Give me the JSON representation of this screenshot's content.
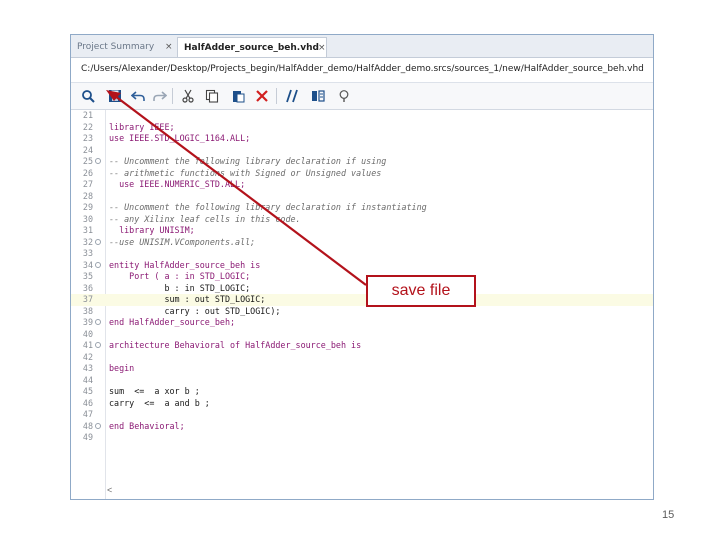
{
  "tabs": [
    {
      "label": "Project Summary",
      "close": "×"
    },
    {
      "label": "HalfAdder_source_beh.vhd *",
      "close": "×"
    }
  ],
  "file_path": "C:/Users/Alexander/Desktop/Projects_begin/HalfAdder_demo/HalfAdder_demo.srcs/sources_1/new/HalfAdder_source_beh.vhd",
  "toolbar_icons": [
    "search-icon",
    "save-icon",
    "undo-icon",
    "redo-icon",
    "cut-icon",
    "copy-icon",
    "paste-icon",
    "delete-icon",
    "comment-icon",
    "block-icon",
    "lightbulb-icon"
  ],
  "editor": {
    "highlighted_line": "37",
    "lines": [
      {
        "n": "21",
        "text": ""
      },
      {
        "n": "22",
        "text": "library IEEE;"
      },
      {
        "n": "23",
        "text": "use IEEE.STD_LOGIC_1164.ALL;"
      },
      {
        "n": "24",
        "text": ""
      },
      {
        "n": "25",
        "text": "-- Uncomment the following library declaration if using"
      },
      {
        "n": "26",
        "text": "-- arithmetic functions with Signed or Unsigned values"
      },
      {
        "n": "27",
        "text": "  use IEEE.NUMERIC_STD.ALL;"
      },
      {
        "n": "28",
        "text": ""
      },
      {
        "n": "29",
        "text": "-- Uncomment the following library declaration if instantiating"
      },
      {
        "n": "30",
        "text": "-- any Xilinx leaf cells in this code."
      },
      {
        "n": "31",
        "text": "  library UNISIM;"
      },
      {
        "n": "32",
        "text": "--use UNISIM.VComponents.all;"
      },
      {
        "n": "33",
        "text": ""
      },
      {
        "n": "34",
        "text": "entity HalfAdder_source_beh is"
      },
      {
        "n": "35",
        "text": "    Port ( a : in STD_LOGIC;"
      },
      {
        "n": "36",
        "text": "           b : in STD_LOGIC;"
      },
      {
        "n": "37",
        "text": "           sum : out STD_LOGIC;"
      },
      {
        "n": "38",
        "text": "           carry : out STD_LOGIC);"
      },
      {
        "n": "39",
        "text": "end HalfAdder_source_beh;"
      },
      {
        "n": "40",
        "text": ""
      },
      {
        "n": "41",
        "text": "architecture Behavioral of HalfAdder_source_beh is"
      },
      {
        "n": "42",
        "text": ""
      },
      {
        "n": "43",
        "text": "begin"
      },
      {
        "n": "44",
        "text": ""
      },
      {
        "n": "45",
        "text": "sum  <=  a xor b ;"
      },
      {
        "n": "46",
        "text": "carry  <=  a and b ;"
      },
      {
        "n": "47",
        "text": ""
      },
      {
        "n": "48",
        "text": "end Behavioral;"
      },
      {
        "n": "49",
        "text": ""
      }
    ],
    "fold_lines": [
      "25",
      "32",
      "34",
      "39",
      "41",
      "48"
    ],
    "scroll_marker": "<"
  },
  "callout": {
    "label": "save file",
    "color": "#b3121b"
  },
  "slide_number": "15"
}
